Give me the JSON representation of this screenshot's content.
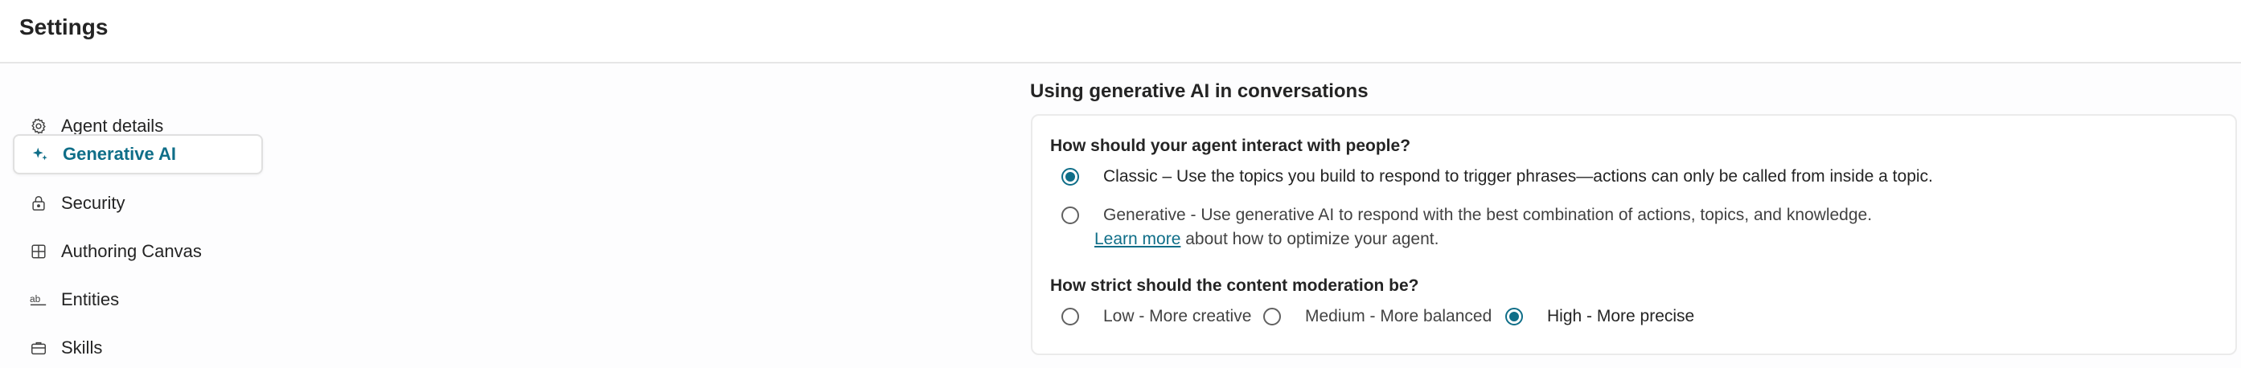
{
  "header": {
    "title": "Settings"
  },
  "sidebar": {
    "items": [
      {
        "label": "Agent details",
        "icon": "gear-icon",
        "active": false
      },
      {
        "label": "Generative AI",
        "icon": "sparkle-icon",
        "active": true
      },
      {
        "label": "Security",
        "icon": "lock-icon",
        "active": false
      },
      {
        "label": "Authoring Canvas",
        "icon": "grid-icon",
        "active": false
      },
      {
        "label": "Entities",
        "icon": "ab-text-icon",
        "active": false
      },
      {
        "label": "Skills",
        "icon": "briefcase-icon",
        "active": false
      }
    ]
  },
  "main": {
    "section_title": "Using generative AI in conversations",
    "interaction": {
      "question": "How should your agent interact with people?",
      "options": [
        {
          "label": "Classic – Use the topics you build to respond to trigger phrases—actions can only be called from inside a topic.",
          "selected": true
        },
        {
          "label": "Generative - Use generative AI to respond with the best combination of actions, topics, and knowledge.",
          "selected": false
        }
      ],
      "learn_more": "Learn more",
      "learn_more_suffix": " about how to optimize your agent."
    },
    "moderation": {
      "question": "How strict should the content moderation be?",
      "options": [
        {
          "label": "Low - More creative",
          "selected": false
        },
        {
          "label": "Medium - More balanced",
          "selected": false
        },
        {
          "label": "High - More precise",
          "selected": true
        }
      ]
    }
  },
  "colors": {
    "accent": "#0f6e88",
    "divider": "#e6e6e6"
  }
}
